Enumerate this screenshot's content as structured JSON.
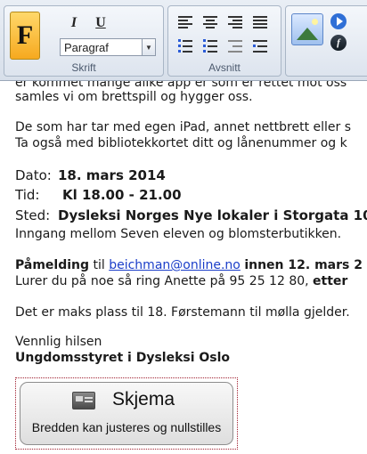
{
  "ribbon": {
    "font_group": {
      "label": "Skrift",
      "big_font_letter": "F",
      "italic_label": "I",
      "underline_label": "U",
      "paragraph_style": "Paragraf"
    },
    "paragraph_group": {
      "label": "Avsnitt"
    },
    "insert_group": {
      "image_icon": "image-icon",
      "media_icon": "play-icon",
      "flash_icon": "flash-icon"
    },
    "accent_color": "#f6a91f"
  },
  "document": {
    "intro_line_1": "er kommet mange alike app er som er rettet mot oss",
    "intro_line_2": "samles vi om brettspill og hygger oss.",
    "ipad_line_1": "De som har tar med egen iPad, annet nettbrett eller s",
    "ipad_line_2": "Ta også med bibliotekkortet ditt og lånenummer og k",
    "date_label": "Dato:",
    "date_value": "18. mars 2014",
    "time_label": "Tid:",
    "time_value": "Kl 18.00 - 21.00",
    "place_label": "Sted:",
    "place_value": "Dysleksi Norges Nye lokaler i Storgata 10/",
    "entrance": "Inngang mellom Seven eleven og blomsterbutikken.",
    "signup_bold": "Påmelding",
    "signup_to": "til",
    "signup_email": "beichman@online.no",
    "signup_deadline": "innen 12. mars 2",
    "questions_text": "Lurer du på noe så ring Anette på 95 25 12 80,",
    "questions_bold": "etter",
    "max_places": "Det er maks plass til 18. Førstemann til mølla gjelder.",
    "greeting": "Vennlig hilsen",
    "signature": "Ungdomsstyret i Dysleksi Oslo"
  },
  "schema_button": {
    "title": "Skjema",
    "subtitle": "Bredden kan justeres og nullstilles",
    "icon": "form-icon"
  }
}
